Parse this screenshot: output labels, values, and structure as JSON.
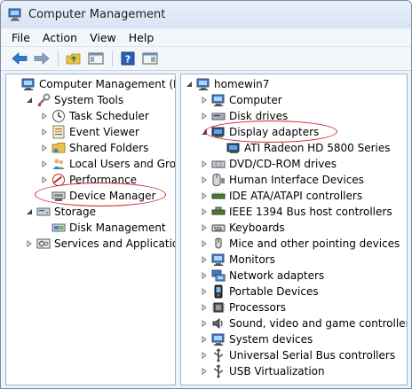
{
  "window": {
    "title": "Computer Management"
  },
  "menu": [
    "File",
    "Action",
    "View",
    "Help"
  ],
  "left_tree": [
    {
      "label": "Computer Management (Local",
      "level": 0,
      "expander": "",
      "icon": "computer-management-icon"
    },
    {
      "label": "System Tools",
      "level": 1,
      "expander": "open",
      "icon": "system-tools-icon"
    },
    {
      "label": "Task Scheduler",
      "level": 2,
      "expander": "closed",
      "icon": "task-scheduler-icon"
    },
    {
      "label": "Event Viewer",
      "level": 2,
      "expander": "closed",
      "icon": "event-viewer-icon"
    },
    {
      "label": "Shared Folders",
      "level": 2,
      "expander": "closed",
      "icon": "shared-folders-icon"
    },
    {
      "label": "Local Users and Groups",
      "level": 2,
      "expander": "closed",
      "icon": "local-users-icon"
    },
    {
      "label": "Performance",
      "level": 2,
      "expander": "closed",
      "icon": "performance-icon"
    },
    {
      "label": "Device Manager",
      "level": 2,
      "expander": "",
      "icon": "device-manager-icon",
      "highlighted": true
    },
    {
      "label": "Storage",
      "level": 1,
      "expander": "open",
      "icon": "storage-icon"
    },
    {
      "label": "Disk Management",
      "level": 2,
      "expander": "",
      "icon": "disk-management-icon"
    },
    {
      "label": "Services and Applications",
      "level": 1,
      "expander": "closed",
      "icon": "services-icon"
    }
  ],
  "right_tree": [
    {
      "label": "homewin7",
      "level": 0,
      "expander": "open",
      "icon": "computer-icon"
    },
    {
      "label": "Computer",
      "level": 1,
      "expander": "closed",
      "icon": "monitor-icon"
    },
    {
      "label": "Disk drives",
      "level": 1,
      "expander": "closed",
      "icon": "disk-drive-icon"
    },
    {
      "label": "Display adapters",
      "level": 1,
      "expander": "open",
      "icon": "display-adapter-icon",
      "highlighted": true
    },
    {
      "label": "ATI Radeon HD 5800 Series",
      "level": 2,
      "expander": "",
      "icon": "display-adapter-icon"
    },
    {
      "label": "DVD/CD-ROM drives",
      "level": 1,
      "expander": "closed",
      "icon": "dvd-drive-icon"
    },
    {
      "label": "Human Interface Devices",
      "level": 1,
      "expander": "closed",
      "icon": "hid-icon"
    },
    {
      "label": "IDE ATA/ATAPI controllers",
      "level": 1,
      "expander": "closed",
      "icon": "ide-controller-icon"
    },
    {
      "label": "IEEE 1394 Bus host controllers",
      "level": 1,
      "expander": "closed",
      "icon": "ieee1394-icon"
    },
    {
      "label": "Keyboards",
      "level": 1,
      "expander": "closed",
      "icon": "keyboard-icon"
    },
    {
      "label": "Mice and other pointing devices",
      "level": 1,
      "expander": "closed",
      "icon": "mouse-icon"
    },
    {
      "label": "Monitors",
      "level": 1,
      "expander": "closed",
      "icon": "monitor-icon"
    },
    {
      "label": "Network adapters",
      "level": 1,
      "expander": "closed",
      "icon": "network-adapter-icon"
    },
    {
      "label": "Portable Devices",
      "level": 1,
      "expander": "closed",
      "icon": "portable-device-icon"
    },
    {
      "label": "Processors",
      "level": 1,
      "expander": "closed",
      "icon": "processor-icon"
    },
    {
      "label": "Sound, video and game controllers",
      "level": 1,
      "expander": "closed",
      "icon": "sound-icon"
    },
    {
      "label": "System devices",
      "level": 1,
      "expander": "closed",
      "icon": "system-devices-icon"
    },
    {
      "label": "Universal Serial Bus controllers",
      "level": 1,
      "expander": "closed",
      "icon": "usb-icon"
    },
    {
      "label": "USB Virtualization",
      "level": 1,
      "expander": "closed",
      "icon": "usb-virtualization-icon"
    }
  ],
  "toolbar": [
    "back-arrow-icon",
    "forward-arrow-icon",
    "up-folder-icon",
    "show-hide-tree-icon",
    "help-icon",
    "properties-icon"
  ],
  "colors": {
    "highlight_oval": "#d6212c"
  }
}
